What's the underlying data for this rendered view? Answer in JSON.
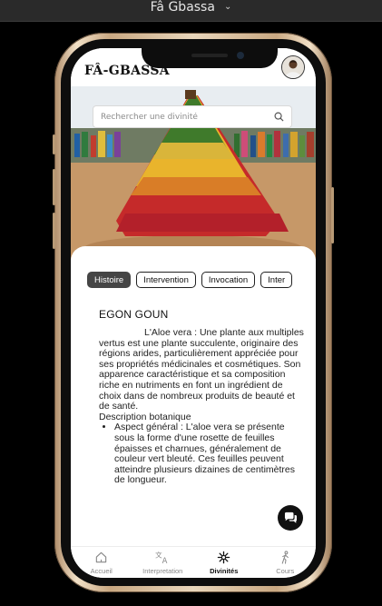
{
  "window": {
    "title": "Fâ Gbassa"
  },
  "app": {
    "brand": "FÂ-GBASSA"
  },
  "search": {
    "placeholder": "Rechercher une divinité"
  },
  "tabs": [
    {
      "label": "Histoire",
      "active": true
    },
    {
      "label": "Intervention",
      "active": false
    },
    {
      "label": "Invocation",
      "active": false
    },
    {
      "label": "Inter",
      "active": false
    }
  ],
  "content": {
    "title": "EGON GOUN",
    "intro": "L'Aloe vera : Une plante aux multiples vertus est une plante succulente, originaire des régions arides, particulièrement appréciée pour ses propriétés médicinales et cosmétiques. Son apparence caractéristique et sa composition riche en nutriments en font un ingrédient de choix dans de nombreux produits de beauté et de santé.",
    "section": "Description botanique",
    "bullets": [
      "Aspect général : L'aloe vera se présente sous la forme d'une rosette de feuilles épaisses et charnues, généralement de couleur vert bleuté. Ces feuilles peuvent atteindre plusieurs dizaines de centimètres de longueur."
    ]
  },
  "nav": [
    {
      "label": "Accueil",
      "icon": "home-icon",
      "active": false
    },
    {
      "label": "Interpretation",
      "icon": "translate-icon",
      "active": false
    },
    {
      "label": "Divinités",
      "icon": "deity-icon",
      "active": true
    },
    {
      "label": "Cours",
      "icon": "walking-icon",
      "active": false
    }
  ],
  "colors": {
    "active_tab": "#454545",
    "fab": "#111111",
    "accent_text": "#111111"
  }
}
